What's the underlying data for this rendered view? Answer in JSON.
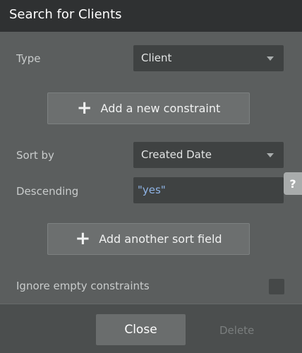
{
  "header": {
    "title": "Search for Clients"
  },
  "type_row": {
    "label": "Type",
    "value": "Client"
  },
  "add_constraint": {
    "label": "Add a new constraint"
  },
  "sort_row": {
    "label": "Sort by",
    "value": "Created Date"
  },
  "descending_row": {
    "label": "Descending",
    "value": "\"yes\""
  },
  "add_sort": {
    "label": "Add another sort field"
  },
  "ignore_row": {
    "label": "Ignore empty constraints"
  },
  "help": {
    "label": "?"
  },
  "footer": {
    "close_label": "Close",
    "delete_label": "Delete"
  }
}
